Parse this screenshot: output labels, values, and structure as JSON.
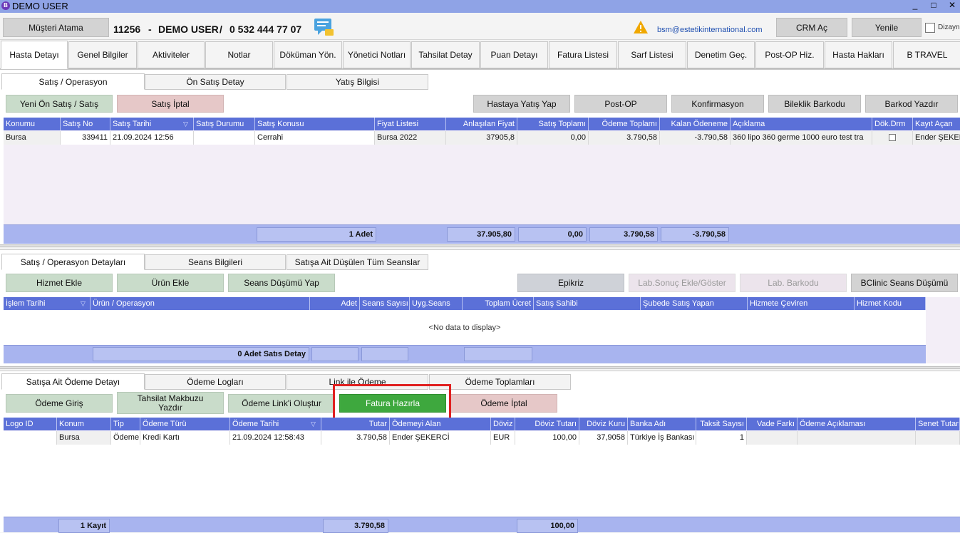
{
  "window": {
    "title": "DEMO USER",
    "logo_letter": "B",
    "controls": [
      "_",
      "□",
      "✕"
    ]
  },
  "topbar": {
    "assign_btn": "Müşteri Atama",
    "patient_id": "11256",
    "sep1": "-",
    "patient_name": "DEMO USER",
    "sep2": "/",
    "phone": "0 532 444 77 07",
    "email": "bsm@estetikinternational.com",
    "crm_btn": "CRM Aç",
    "refresh_btn": "Yenile",
    "design_label": "Dizayn"
  },
  "main_tabs": [
    "Hasta Detayı",
    "Genel Bilgiler",
    "Aktiviteler",
    "Notlar",
    "Döküman Yön.",
    "Yönetici Notları",
    "Tahsilat Detay",
    "Puan Detayı",
    "Fatura Listesi",
    "Sarf Listesi",
    "Denetim Geç.",
    "Post-OP Hiz.",
    "Hasta Hakları",
    "B TRAVEL"
  ],
  "sales": {
    "tabs": [
      "Satış / Operasyon",
      "Ön Satış Detay",
      "Yatış Bilgisi"
    ],
    "buttons": {
      "new": "Yeni Ön Satış / Satış",
      "cancel": "Satış İptal",
      "admit": "Hastaya Yatış Yap",
      "postop": "Post-OP",
      "confirm": "Konfirmasyon",
      "bracelet": "Bileklik Barkodu",
      "print_barcode": "Barkod Yazdır"
    },
    "columns": [
      "Konumu",
      "Satış No",
      "Satış Tarihi",
      "Satış Durumu",
      "Satış Konusu",
      "Fiyat Listesi",
      "Anlaşılan Fiyat",
      "Satış Toplamı",
      "Ödeme Toplamı",
      "Kalan Ödeneme",
      "Açıklama",
      "Dök.Drm",
      "Kayıt Açan"
    ],
    "rows": [
      {
        "konum": "Bursa",
        "no": "339411",
        "tarih": "21.09.2024 12:56",
        "durum": "",
        "konu": "Cerrahi",
        "fiyat_listesi": "Bursa 2022",
        "anlasilan": "37905,8",
        "satis_toplam": "0,00",
        "odeme_toplam": "3.790,58",
        "kalan": "-3.790,58",
        "aciklama": "360 lipo 360 germe 1000 euro test tra",
        "kayit_acan": "Ender ŞEKERCİ"
      }
    ],
    "footer": {
      "count": "1 Adet",
      "anlasilan": "37.905,80",
      "satis": "0,00",
      "odeme": "3.790,58",
      "kalan": "-3.790,58"
    }
  },
  "details": {
    "tabs": [
      "Satış / Operasyon Detayları",
      "Seans Bilgileri",
      "Satışa Ait Düşülen Tüm Seanslar"
    ],
    "buttons": {
      "add_service": "Hizmet Ekle",
      "add_product": "Ürün Ekle",
      "session_drop": "Seans Düşümü Yap",
      "epikriz": "Epikriz",
      "lab_result": "Lab.Sonuç Ekle/Göster",
      "lab_barcode": "Lab. Barkodu",
      "bclinic": "BClinic Seans Düşümü"
    },
    "columns": [
      "İşlem Tarihi",
      "Ürün / Operasyon",
      "Adet",
      "Seans Sayısı",
      "Uyg.Seans",
      "Toplam Ücret",
      "Satış Sahibi",
      "Şubede Satış Yapan",
      "Hizmete Çeviren",
      "Hizmet Kodu"
    ],
    "empty": "<No data to display>",
    "footer": {
      "count": "0 Adet Satıs Detay"
    }
  },
  "payments": {
    "tabs": [
      "Satışa Ait Ödeme Detayı",
      "Ödeme Logları",
      "Link ile Ödeme",
      "Ödeme Toplamları"
    ],
    "buttons": {
      "entry": "Ödeme Giriş",
      "receipt": "Tahsilat Makbuzu Yazdır",
      "link": "Ödeme Link'i Oluştur",
      "invoice": "Fatura Hazırla",
      "cancel": "Ödeme İptal"
    },
    "columns": [
      "Logo ID",
      "Konum",
      "Tip",
      "Ödeme Türü",
      "Ödeme Tarihi",
      "Tutar",
      "Ödemeyi Alan",
      "Döviz",
      "Döviz Tutarı",
      "Döviz Kuru",
      "Banka Adı",
      "Taksit Sayısı",
      "Vade Farkı",
      "Ödeme Açıklaması",
      "Senet Tutarı"
    ],
    "rows": [
      {
        "logo": "",
        "konum": "Bursa",
        "tip": "Ödeme",
        "tur": "Kredi Kartı",
        "tarih": "21.09.2024 12:58:43",
        "tutar": "3.790,58",
        "alan": "Ender ŞEKERCİ",
        "doviz": "EUR",
        "doviz_tutar": "100,00",
        "kur": "37,9058",
        "banka": "Türkiye İş Bankası",
        "taksit": "1",
        "vade": "",
        "aciklama": "",
        "senet": ""
      }
    ],
    "footer": {
      "count": "1 Kayıt",
      "tutar": "3.790,58",
      "doviz_tutar": "100,00"
    }
  },
  "colors": {
    "header": "#5b70d8",
    "footer": "#a8b4ef",
    "highlight": "#e02020",
    "green_btn": "#3ea83e"
  }
}
